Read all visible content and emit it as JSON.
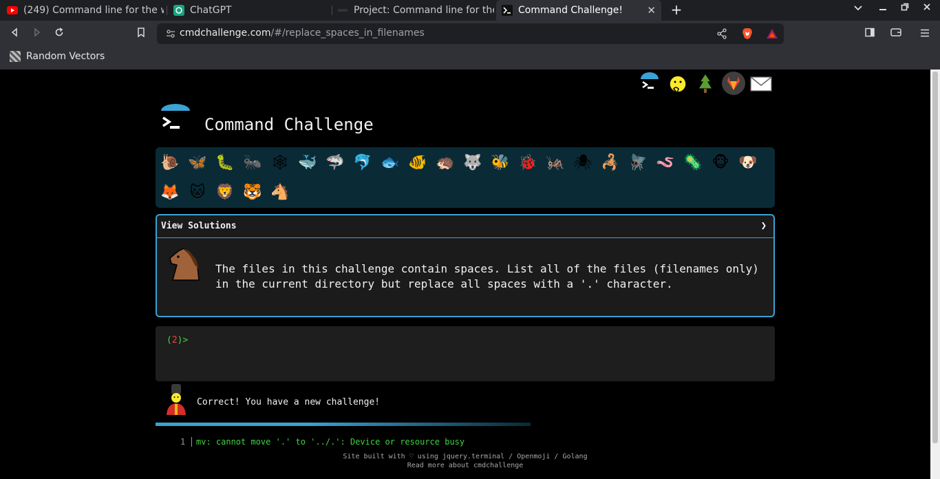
{
  "browser": {
    "tabs": [
      {
        "title": "(249) Command line for the w",
        "icon": "youtube-icon"
      },
      {
        "title": "ChatGPT",
        "icon": "chatgpt-icon"
      },
      {
        "title": "Project: Command line for the",
        "icon": "project-icon"
      },
      {
        "title": "Command Challenge!",
        "icon": "terminal-icon",
        "active": true
      }
    ],
    "url_host": "cmdchallenge.com",
    "url_path": "/#/replace_spaces_in_filenames",
    "bookmarks": [
      {
        "label": "Random Vectors"
      }
    ]
  },
  "page": {
    "title": "Command Challenge",
    "challenge_emojis": [
      "🐌",
      "🦋",
      "🐛",
      "🐜",
      "🕸",
      "🐳",
      "🦈",
      "🐬",
      "🐟",
      "🐠",
      "🦔",
      "🐺",
      "🐝",
      "🐞",
      "🦗",
      "🕷",
      "🦂",
      "🪰",
      "🪱",
      "🦠",
      "🐵",
      "🐶",
      "🦊",
      "🐱",
      "🦁",
      "🐯",
      "🐴"
    ],
    "view_solutions_label": "View Solutions",
    "chevron": "❯",
    "description_line1": "The files in this challenge contain spaces. List all of the files (filenames only)",
    "description_line2": "in the current directory but replace all spaces with a '.' character.",
    "prompt_open": "(",
    "prompt_num": "2",
    "prompt_close": ")>",
    "message": "Correct! You have a new challenge!",
    "progress": 0.4,
    "output_line_number": "1",
    "output_text": "mv: cannot move '.' to '../.': Device or resource busy",
    "footer_line1": "Site built with ♡ using jquery.terminal / Openmoji / Golang",
    "footer_line2": "Read more about cmdchallenge"
  },
  "colors": {
    "accent": "#3aa3d6",
    "panel": "#0a2a36",
    "prompt_green": "#3fd43f",
    "prompt_red": "#f04040"
  }
}
